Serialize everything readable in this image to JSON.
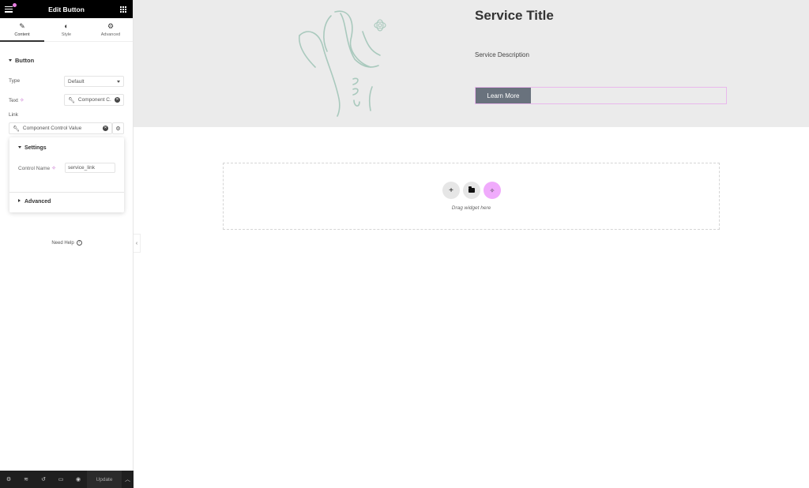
{
  "panel": {
    "header": {
      "title": "Edit Button",
      "menu_icon": "hamburger-icon",
      "apps_icon": "grid-icon"
    },
    "tabs": [
      {
        "label": "Content",
        "icon": "pencil-icon",
        "active": true
      },
      {
        "label": "Style",
        "icon": "half-circle-icon",
        "active": false
      },
      {
        "label": "Advanced",
        "icon": "gear-icon",
        "active": false
      }
    ],
    "section": {
      "title": "Button"
    },
    "fields": {
      "type": {
        "label": "Type",
        "value": "Default"
      },
      "text": {
        "label": "Text",
        "value": "Component C..."
      },
      "link": {
        "label": "Link",
        "value": "Component Control Value"
      }
    },
    "popover": {
      "settings_title": "Settings",
      "control_name_label": "Control Name",
      "control_name_value": "service_link",
      "advanced_title": "Advanced"
    },
    "help": {
      "label": "Need Help"
    },
    "footer": {
      "update_label": "Update"
    }
  },
  "canvas": {
    "hero": {
      "title": "Service Title",
      "description": "Service Description",
      "button_label": "Learn More"
    },
    "dropzone": {
      "hint": "Drag widget here"
    }
  },
  "colors": {
    "accent_ai": "#c15fc8",
    "ai_button": "#f0abfc",
    "selection_outline": "#e9b8ec",
    "button_bg": "#69727d",
    "hero_bg": "#ebebeb"
  }
}
